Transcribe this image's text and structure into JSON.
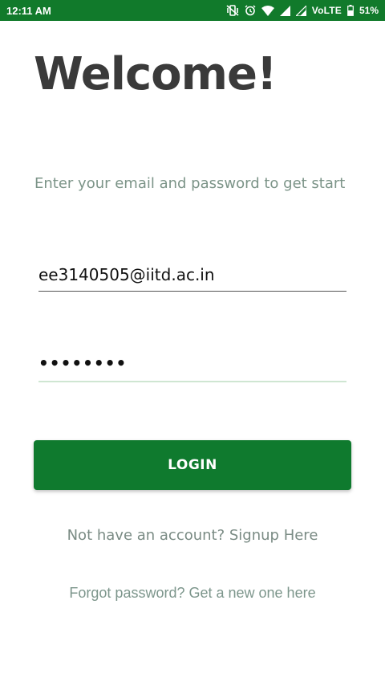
{
  "status_bar": {
    "time": "12:11 AM",
    "network_label": "VoLTE",
    "battery_percent": "51%",
    "icons": [
      "vibrate-icon",
      "alarm-icon",
      "wifi-icon",
      "signal-icon",
      "signal-secondary-icon",
      "battery-icon"
    ],
    "background_color": "#117a2b"
  },
  "header": {
    "title": "Welcome!",
    "subtitle": "Enter your email and password to get start"
  },
  "form": {
    "email_value": "ee3140505@iitd.ac.in",
    "password_value": "••••••••",
    "login_label": "LOGIN"
  },
  "links": {
    "signup": "Not have an account? Signup Here",
    "forgot": "Forgot password? Get a new one here"
  },
  "colors": {
    "accent": "#0f7a2e",
    "title_text": "#3a3a3a",
    "muted_text": "#7c9488"
  }
}
